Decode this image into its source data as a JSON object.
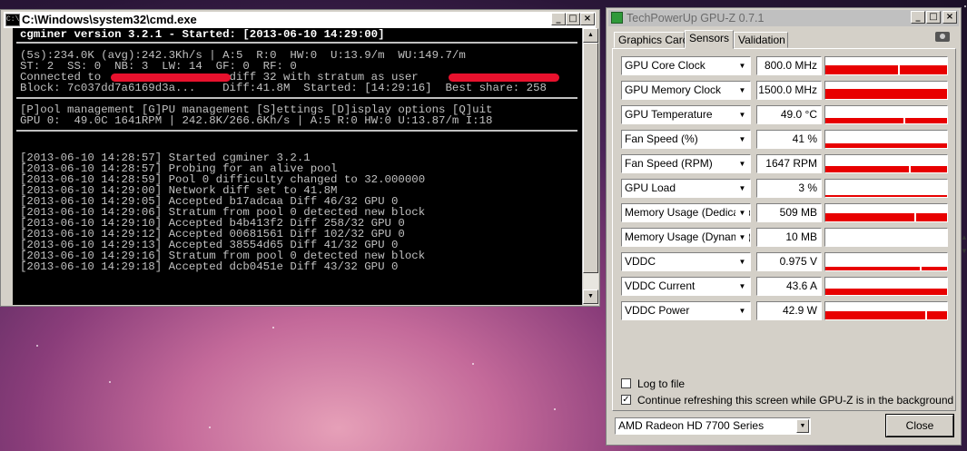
{
  "cmd": {
    "title": "C:\\Windows\\system32\\cmd.exe",
    "icon": "cmd-icon",
    "header": "cgminer version 3.2.1 - Started: [2013-06-10 14:29:00]",
    "stats": [
      "(5s):234.0K (avg):242.3Kh/s | A:5  R:0  HW:0  U:13.9/m  WU:149.7/m",
      "ST: 2  SS: 0  NB: 3  LW: 14  GF: 0  RF: 0",
      "Connected to                   diff 32 with stratum as user",
      "Block: 7c037dd7a6169d3a...    Diff:41.8M  Started: [14:29:16]  Best share: 258"
    ],
    "menu": "[P]ool management [G]PU management [S]ettings [D]isplay options [Q]uit",
    "gpu": "GPU 0:  49.0C 1641RPM | 242.8K/266.6Kh/s | A:5 R:0 HW:0 U:13.87/m I:18",
    "log": [
      "[2013-06-10 14:28:57] Started cgminer 3.2.1",
      "[2013-06-10 14:28:57] Probing for an alive pool",
      "[2013-06-10 14:28:59] Pool 0 difficulty changed to 32.000000",
      "[2013-06-10 14:29:00] Network diff set to 41.8M",
      "[2013-06-10 14:29:05] Accepted b17adcaa Diff 46/32 GPU 0",
      "[2013-06-10 14:29:06] Stratum from pool 0 detected new block",
      "[2013-06-10 14:29:10] Accepted b4b413f2 Diff 258/32 GPU 0",
      "[2013-06-10 14:29:12] Accepted 00681561 Diff 102/32 GPU 0",
      "[2013-06-10 14:29:13] Accepted 38554d65 Diff 41/32 GPU 0",
      "[2013-06-10 14:29:16] Stratum from pool 0 detected new block",
      "[2013-06-10 14:29:18] Accepted dcb0451e Diff 43/32 GPU 0"
    ],
    "buttons": {
      "minimize": "_",
      "maximize": "□",
      "close": "×"
    }
  },
  "gpuz": {
    "title": "TechPowerUp GPU-Z 0.7.1",
    "tabs": [
      "Graphics Card",
      "Sensors",
      "Validation"
    ],
    "active_tab": "Sensors",
    "graph_color": "#e80000",
    "sensors": [
      {
        "label": "GPU Core Clock",
        "value": "800.0 MHz",
        "level": 0.55
      },
      {
        "label": "GPU Memory Clock",
        "value": "1500.0 MHz",
        "level": 0.6
      },
      {
        "label": "GPU Temperature",
        "value": "49.0 °C",
        "level": 0.3
      },
      {
        "label": "Fan Speed (%)",
        "value": "41 %",
        "level": 0.25
      },
      {
        "label": "Fan Speed (RPM)",
        "value": "1647 RPM",
        "level": 0.35
      },
      {
        "label": "GPU Load",
        "value": "3 %",
        "level": 0.05
      },
      {
        "label": "Memory Usage (Dedicated)",
        "value": "509 MB",
        "level": 0.45
      },
      {
        "label": "Memory Usage (Dynamic)",
        "value": "10 MB",
        "level": 0.0
      },
      {
        "label": "VDDC",
        "value": "0.975 V",
        "level": 0.2
      },
      {
        "label": "VDDC Current",
        "value": "43.6 A",
        "level": 0.35
      },
      {
        "label": "VDDC Power",
        "value": "42.9 W",
        "level": 0.45
      }
    ],
    "log_to_file": {
      "label": "Log to file",
      "checked": false
    },
    "continue_refresh": {
      "label": "Continue refreshing this screen while GPU-Z is in the background",
      "checked": true
    },
    "card_select": "AMD Radeon HD 7700 Series",
    "close_label": "Close",
    "buttons": {
      "minimize": "_",
      "maximize": "□",
      "close": "×"
    }
  }
}
